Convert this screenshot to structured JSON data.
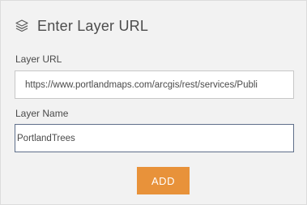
{
  "dialog": {
    "title": "Enter Layer URL",
    "title_icon": "layers-icon",
    "fields": {
      "layer_url": {
        "label": "Layer URL",
        "value": "https://www.portlandmaps.com/arcgis/rest/services/Publi"
      },
      "layer_name": {
        "label": "Layer Name",
        "value": "PortlandTrees"
      }
    },
    "add_button_label": "ADD"
  },
  "colors": {
    "panel_background": "#f2f2f2",
    "accent_button": "#e8923a",
    "text": "#4a4a4a",
    "focused_border": "#5f6f8a"
  }
}
